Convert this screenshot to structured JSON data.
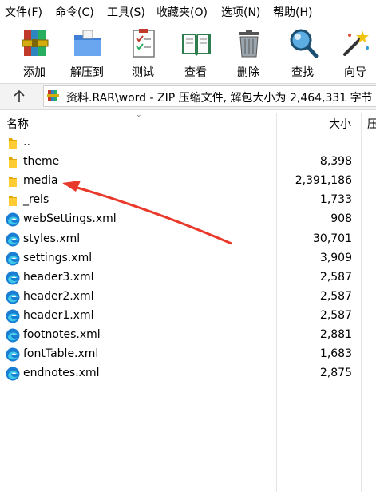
{
  "menu": [
    "文件(F)",
    "命令(C)",
    "工具(S)",
    "收藏夹(O)",
    "选项(N)",
    "帮助(H)"
  ],
  "toolbar": [
    {
      "label": "添加",
      "icon": "archive-books-icon"
    },
    {
      "label": "解压到",
      "icon": "folder-extract-icon"
    },
    {
      "label": "测试",
      "icon": "clipboard-check-icon"
    },
    {
      "label": "查看",
      "icon": "open-book-icon"
    },
    {
      "label": "删除",
      "icon": "trash-can-icon"
    },
    {
      "label": "查找",
      "icon": "magnifier-icon"
    },
    {
      "label": "向导",
      "icon": "magic-wand-icon"
    }
  ],
  "address": {
    "text": "资料.RAR\\word - ZIP 压缩文件, 解包大小为 2,464,331 字节"
  },
  "columns": {
    "name": "名称",
    "size": "大小",
    "packed": "压"
  },
  "files": [
    {
      "name": "..",
      "size": "",
      "type": "folder"
    },
    {
      "name": "theme",
      "size": "8,398",
      "type": "folder"
    },
    {
      "name": "media",
      "size": "2,391,186",
      "type": "folder"
    },
    {
      "name": "_rels",
      "size": "1,733",
      "type": "folder"
    },
    {
      "name": "webSettings.xml",
      "size": "908",
      "type": "xml"
    },
    {
      "name": "styles.xml",
      "size": "30,701",
      "type": "xml"
    },
    {
      "name": "settings.xml",
      "size": "3,909",
      "type": "xml"
    },
    {
      "name": "header3.xml",
      "size": "2,587",
      "type": "xml"
    },
    {
      "name": "header2.xml",
      "size": "2,587",
      "type": "xml"
    },
    {
      "name": "header1.xml",
      "size": "2,587",
      "type": "xml"
    },
    {
      "name": "footnotes.xml",
      "size": "2,881",
      "type": "xml"
    },
    {
      "name": "fontTable.xml",
      "size": "1,683",
      "type": "xml"
    },
    {
      "name": "endnotes.xml",
      "size": "2,875",
      "type": "xml"
    }
  ],
  "annotation": {
    "color": "#e8392b",
    "points_to": "media"
  }
}
